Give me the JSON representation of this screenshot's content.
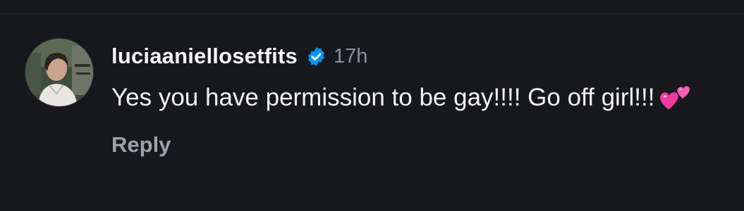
{
  "comment": {
    "avatar_icon": "profile-photo",
    "username": "luciaaniellosetfits",
    "verified_icon": "verified-badge-icon",
    "timestamp": "17h",
    "text": "Yes you have permission to be gay!!!! Go off girl!!!",
    "emoji_icon": "two-hearts-emoji",
    "reply_label": "Reply"
  },
  "colors": {
    "background": "#16181c",
    "text_primary": "#f2f2f2",
    "text_secondary": "#8e919a",
    "verified_blue": "#0095f6",
    "heart_pink": "#f03a9f"
  }
}
